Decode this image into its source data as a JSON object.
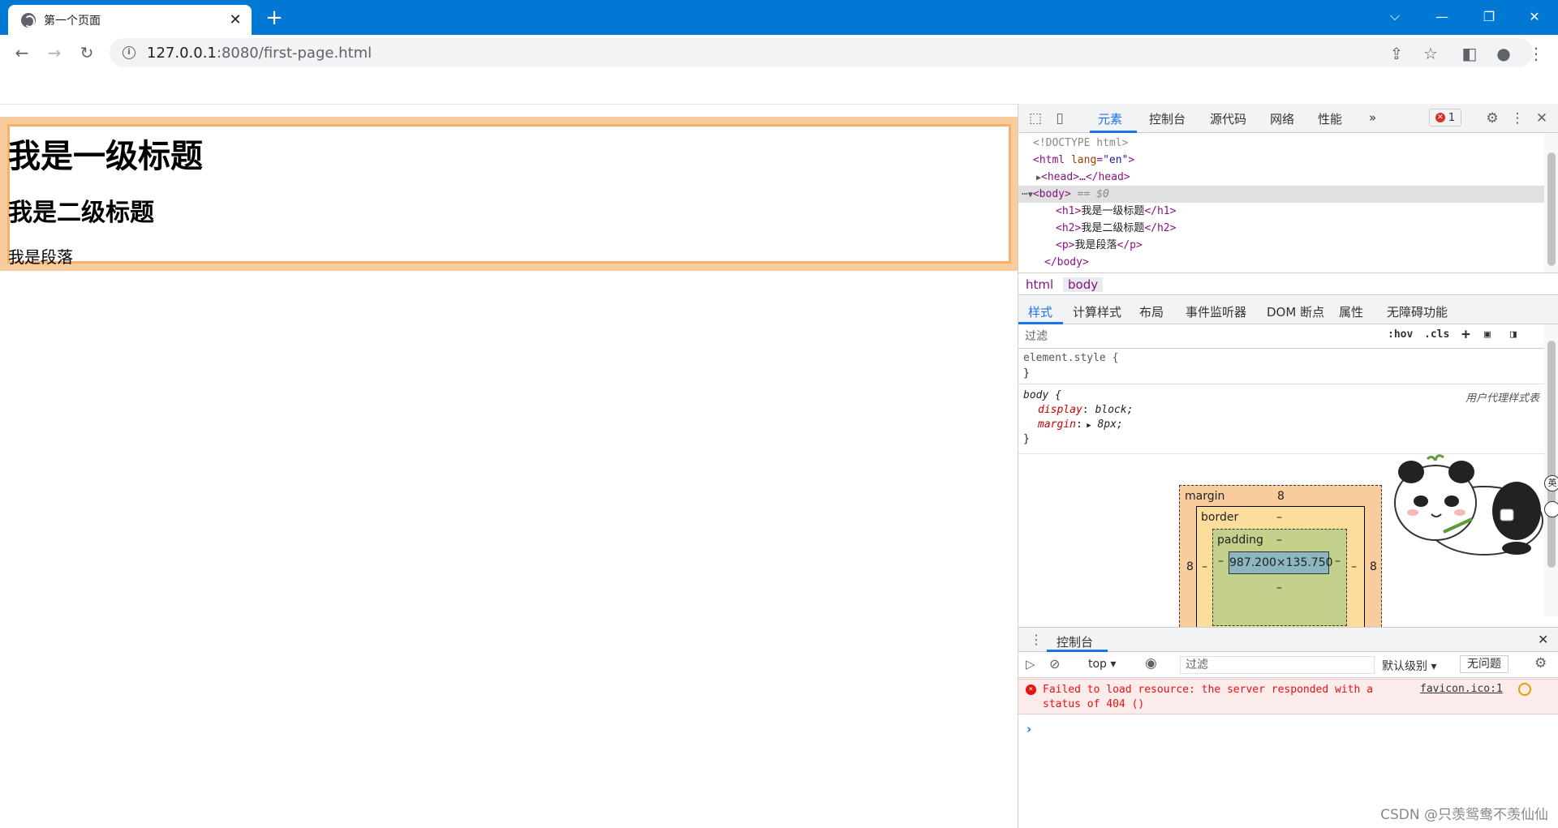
{
  "browser": {
    "tab_title": "第一个页面",
    "tab_close": "✕",
    "new_tab": "+",
    "url_host": "127.0.0.1",
    "url_rest": ":8080/first-page.html",
    "win_chevron": "⌵",
    "win_min": "—",
    "win_max": "❐",
    "win_close": "✕"
  },
  "page": {
    "h1": "我是一级标题",
    "h2": "我是二级标题",
    "p": "我是段落"
  },
  "devtools": {
    "tabs": [
      "元素",
      "控制台",
      "源代码",
      "网络",
      "性能",
      "»"
    ],
    "error_count": "1",
    "dom": {
      "doctype": "<!DOCTYPE html>",
      "html_open": "<html ",
      "html_attr": "lang",
      "html_attr_val": "\"en\"",
      "head": "<head>…</head>",
      "body_open": "<body>",
      "body_eq": " == $0",
      "h1_open": "<h1>",
      "h1_text": "我是一级标题",
      "h1_close": "</h1>",
      "h2_open": "<h2>",
      "h2_text": "我是二级标题",
      "h2_close": "</h2>",
      "p_open": "<p>",
      "p_text": "我是段落",
      "p_close": "</p>",
      "body_close": "</body>"
    },
    "breadcrumbs": [
      "html",
      "body"
    ],
    "styles_tabs": [
      "样式",
      "计算样式",
      "布局",
      "事件监听器",
      "DOM 断点",
      "属性",
      "无障碍功能"
    ],
    "filter_placeholder": "过滤",
    "filter_hov": ":hov",
    "filter_cls": ".cls",
    "rules": {
      "element_style": "element.style {",
      "close": "}",
      "body_sel": "body {",
      "ua_label": "用户代理样式表",
      "display_prop": "display",
      "display_val": " block;",
      "margin_prop": "margin",
      "margin_val": " 8px;"
    },
    "box_model": {
      "margin_label": "margin",
      "margin_top": "8",
      "margin_left": "8",
      "margin_right": "8",
      "border_label": "border",
      "border_top": "–",
      "border_left": "–",
      "border_right": "–",
      "border_bottom": "–",
      "padding_label": "padding",
      "padding_top": "–",
      "padding_left": "–",
      "padding_right": "–",
      "padding_bottom": "–",
      "content": "987.200×135.750"
    },
    "side_icon_label": "英",
    "console": {
      "title": "控制台",
      "context": "top ▾",
      "filter_placeholder": "过滤",
      "level": "默认级别 ▾",
      "issues": "无问题",
      "error_msg": "Failed to load resource: the server responded with a status of 404 ()",
      "error_src": "favicon.ico:1",
      "prompt": "›"
    }
  },
  "watermark": "CSDN @只羡鸳鸯不羡仙仙",
  "colors": {
    "titlebar": "#0078d4",
    "accent": "#1a73e8",
    "margin_box": "#f9cc9d",
    "border_box": "#fddd9b",
    "padding_box": "#c3d08b",
    "content_box": "#8cb6c0"
  }
}
